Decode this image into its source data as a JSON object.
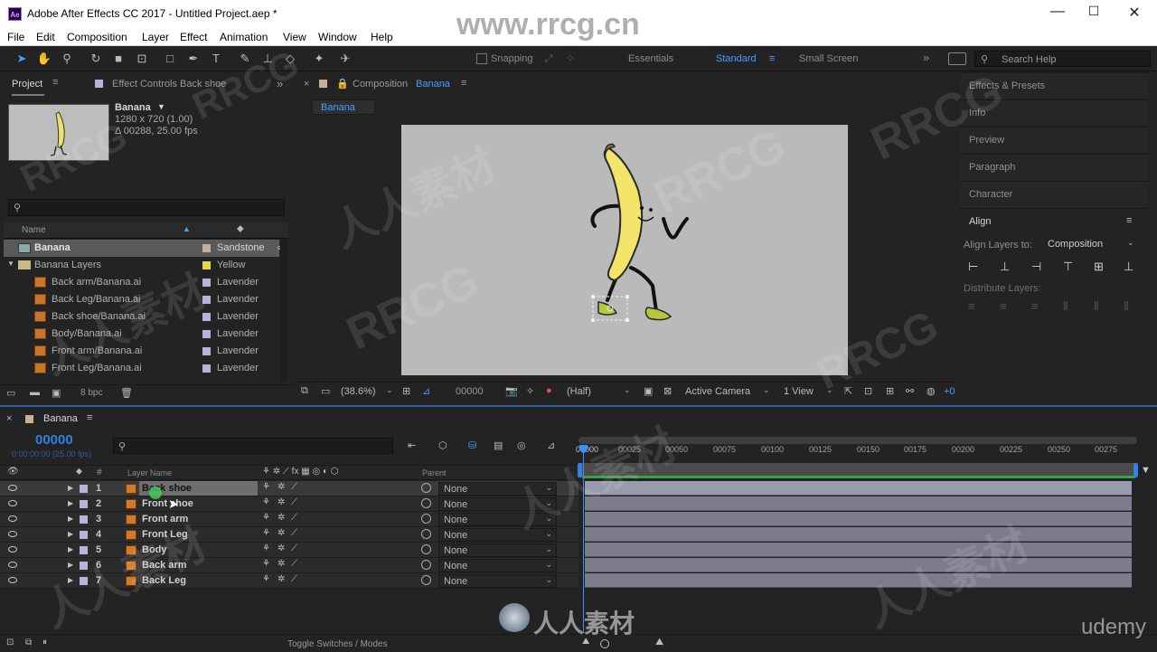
{
  "window": {
    "title": "Adobe After Effects CC 2017 - Untitled Project.aep *",
    "logo": "Ae",
    "minimize": "—",
    "maximize": "☐",
    "close": "✕"
  },
  "menu": [
    "File",
    "Edit",
    "Composition",
    "Layer",
    "Effect",
    "Animation",
    "View",
    "Window",
    "Help"
  ],
  "toolbar": {
    "snapping": "Snapping",
    "workspaces": [
      "Essentials",
      "Standard",
      "Small Screen"
    ],
    "active_workspace": "Standard",
    "search_placeholder": "Search Help"
  },
  "project_panel": {
    "tab": "Project",
    "effect_controls_tab": "Effect Controls Back shoe",
    "comp_name": "Banana",
    "comp_size": "1280 x 720 (1.00)",
    "comp_duration": "Δ 00288, 25.00 fps",
    "col_name": "Name",
    "bpc": "8 bpc",
    "items": [
      {
        "name": "Banana",
        "label": "Sandstone",
        "color": "#c6b09a",
        "type": "comp"
      },
      {
        "name": "Banana Layers",
        "label": "Yellow",
        "color": "#e5d64a",
        "type": "folder"
      },
      {
        "name": "Back arm/Banana.ai",
        "label": "Lavender",
        "color": "#b4b4dc",
        "type": "file"
      },
      {
        "name": "Back Leg/Banana.ai",
        "label": "Lavender",
        "color": "#b4b4dc",
        "type": "file"
      },
      {
        "name": "Back shoe/Banana.ai",
        "label": "Lavender",
        "color": "#b4b4dc",
        "type": "file"
      },
      {
        "name": "Body/Banana.ai",
        "label": "Lavender",
        "color": "#b4b4dc",
        "type": "file"
      },
      {
        "name": "Front arm/Banana.ai",
        "label": "Lavender",
        "color": "#b4b4dc",
        "type": "file"
      },
      {
        "name": "Front Leg/Banana.ai",
        "label": "Lavender",
        "color": "#b4b4dc",
        "type": "file"
      }
    ]
  },
  "composition_panel": {
    "tab_prefix": "Composition",
    "tab_name": "Banana",
    "sub_tab": "Banana",
    "zoom": "(38.6%)",
    "timecode": "00000",
    "resolution": "(Half)",
    "camera": "Active Camera",
    "views": "1 View",
    "plus": "+0"
  },
  "right_panel": {
    "items": [
      "Effects & Presets",
      "Info",
      "Preview",
      "Paragraph",
      "Character"
    ],
    "align_title": "Align",
    "align_layers_to_label": "Align Layers to:",
    "align_layers_to_value": "Composition",
    "distribute_label": "Distribute Layers:"
  },
  "timeline": {
    "tab": "Banana",
    "timecode": "00000",
    "timecode_sub": "0:00:00:00 (25.00 fps)",
    "col_layer_name": "Layer Name",
    "col_parent": "Parent",
    "col_hash": "#",
    "ruler": [
      "00000",
      "00025",
      "00050",
      "00075",
      "00100",
      "00125",
      "00150",
      "00175",
      "00200",
      "00225",
      "00250",
      "00275"
    ],
    "toggle_label": "Toggle Switches / Modes",
    "layers": [
      {
        "num": "1",
        "name": "Back shoe",
        "parent": "None",
        "selected": true
      },
      {
        "num": "2",
        "name": "Front shoe",
        "parent": "None"
      },
      {
        "num": "3",
        "name": "Front arm",
        "parent": "None"
      },
      {
        "num": "4",
        "name": "Front Leg",
        "parent": "None"
      },
      {
        "num": "5",
        "name": "Body",
        "parent": "None"
      },
      {
        "num": "6",
        "name": "Back arm",
        "parent": "None"
      },
      {
        "num": "7",
        "name": "Back Leg",
        "parent": "None"
      }
    ]
  },
  "overlays": {
    "site": "www.rrcg.cn",
    "brand": "RRCG",
    "cn": "人人素材",
    "udemy": "udemy"
  }
}
